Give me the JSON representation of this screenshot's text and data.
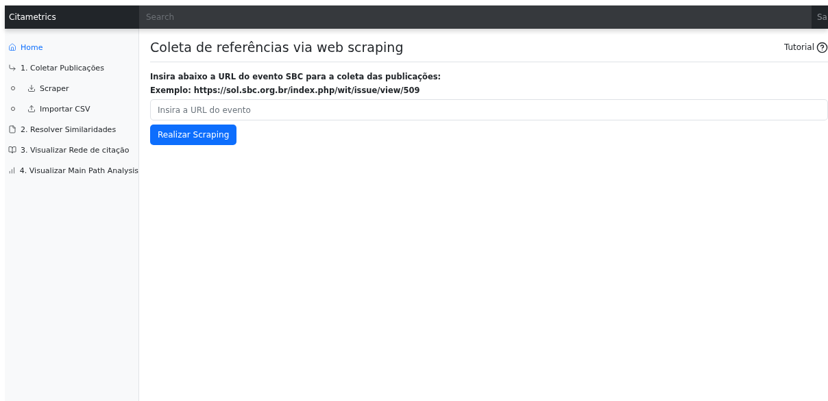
{
  "navbar": {
    "brand": "Citametrics",
    "search": {
      "placeholder": "Search"
    },
    "action": "Sa"
  },
  "sidebar": {
    "items": [
      {
        "label": "Home",
        "kind": "home",
        "selected": true
      },
      {
        "label": "1. Coletar Publicações",
        "kind": "branch",
        "selected": false,
        "children": [
          {
            "label": "Scraper",
            "kind": "download",
            "selected": false
          },
          {
            "label": "Importar CSV",
            "kind": "upload",
            "selected": false
          }
        ]
      },
      {
        "label": "2. Resolver Similaridades",
        "kind": "file",
        "selected": false
      },
      {
        "label": "3. Visualizar Rede de citação",
        "kind": "book",
        "selected": false
      },
      {
        "label": "4. Visualizar Main Path Analysis",
        "kind": "chart",
        "selected": false
      }
    ]
  },
  "main": {
    "title": "Coleta de referências via web scraping",
    "tutorial": "Tutorial",
    "instruction": "Insira abaixo a URL do evento SBC para a coleta das publicações:",
    "example": "Exemplo: https://sol.sbc.org.br/index.php/wit/issue/view/509",
    "url_field": {
      "placeholder": "Insira a URL do evento"
    },
    "submit": "Realizar Scraping"
  }
}
